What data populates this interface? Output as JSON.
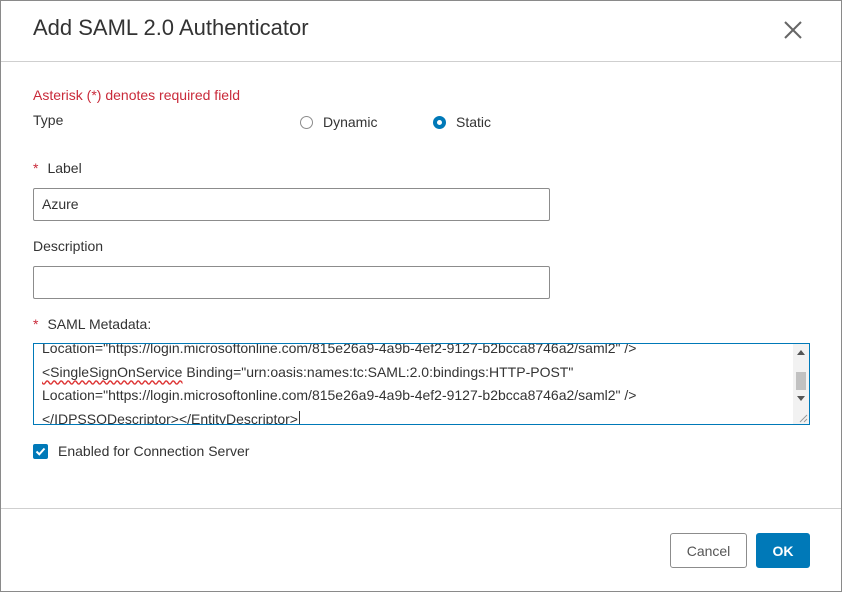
{
  "dialog": {
    "title": "Add SAML 2.0 Authenticator",
    "required_note": "Asterisk (*) denotes required field"
  },
  "type_field": {
    "label": "Type",
    "options": [
      {
        "label": "Dynamic",
        "selected": false
      },
      {
        "label": "Static",
        "selected": true
      }
    ]
  },
  "label_field": {
    "required_mark": "*",
    "label": "Label",
    "value": "Azure"
  },
  "description_field": {
    "label": "Description",
    "value": ""
  },
  "metadata_field": {
    "required_mark": "*",
    "label": "SAML Metadata:",
    "lines": {
      "l0": "Location=\"https://login.microsoftonline.com/815e26a9-4a9b-4ef2-9127-b2bcca8746a2/saml2\" />",
      "l1_tag": "<SingleSignOnService",
      "l1_rest": " Binding=\"urn:oasis:names:tc:SAML:2.0:bindings:HTTP-POST\"",
      "l2": "Location=\"https://login.microsoftonline.com/815e26a9-4a9b-4ef2-9127-b2bcca8746a2/saml2\" />",
      "l3_a": "</IDPSSODescriptor>",
      "l3_b": "</EntityDescriptor>"
    }
  },
  "connection_server": {
    "label": "Enabled for Connection Server",
    "checked": true
  },
  "footer": {
    "cancel_label": "Cancel",
    "ok_label": "OK"
  },
  "colors": {
    "accent": "#0079b8",
    "required": "#c92a3a"
  },
  "icons": {
    "close": "close-icon",
    "check": "checkmark-icon"
  }
}
